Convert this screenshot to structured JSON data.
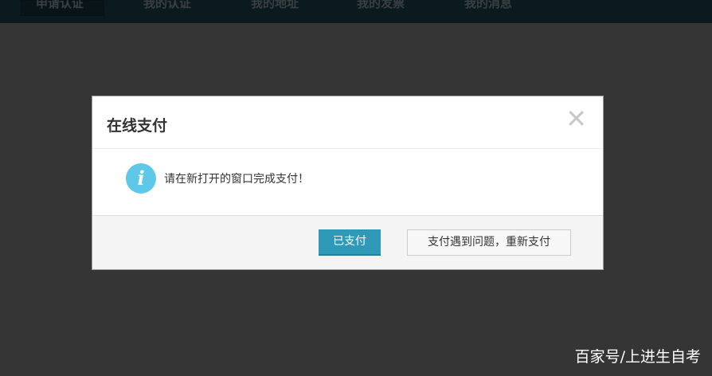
{
  "nav": {
    "items": [
      "申请认证",
      "我的认证",
      "我的地址",
      "我的发票",
      "我的消息"
    ]
  },
  "dialog": {
    "title": "在线支付",
    "message": "请在新打开的窗口完成支付！",
    "paid_button": "已支付",
    "retry_button": "支付遇到问题，重新支付"
  },
  "watermark": "百家号/上进生自考"
}
